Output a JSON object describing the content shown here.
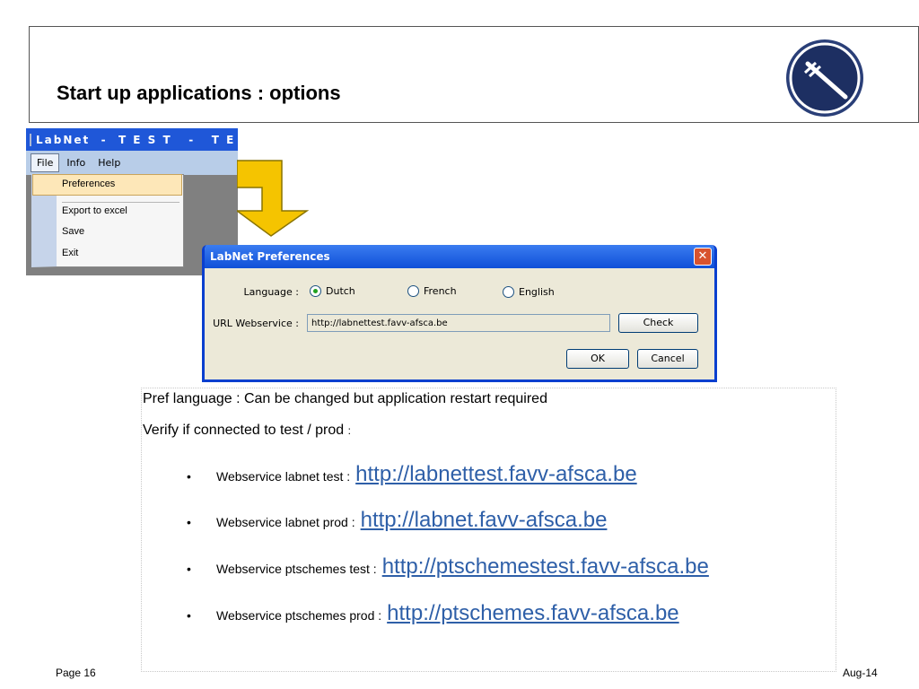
{
  "slide": {
    "title": "Start up applications : options",
    "footer_left": "Page 16",
    "footer_right": "Aug-14"
  },
  "app_window": {
    "title": "LabNet  -  T E S T   -   T E S T",
    "menu": [
      "File",
      "Info",
      "Help"
    ],
    "dropdown": [
      "Preferences",
      "Export to excel",
      "Save",
      "Exit"
    ]
  },
  "dialog": {
    "title": "LabNet Preferences",
    "close_label": "✕",
    "language_label": "Language :",
    "languages": [
      {
        "label": "Dutch",
        "selected": true
      },
      {
        "label": "French",
        "selected": false
      },
      {
        "label": "English",
        "selected": false
      }
    ],
    "url_label": "URL Webservice :",
    "url_value": "http://labnettest.favv-afsca.be",
    "check_button": "Check",
    "ok_button": "OK",
    "cancel_button": "Cancel"
  },
  "content": {
    "line1": "Pref language : Can be changed but application restart required",
    "line2_main": "Verify if connected to test / prod ",
    "line2_colon": ":",
    "bullet_char": "•",
    "bullets": [
      {
        "label": "Webservice labnet test :",
        "url": "http://labnettest.favv-afsca.be"
      },
      {
        "label": "Webservice labnet prod :",
        "url": "http://labnet.favv-afsca.be"
      },
      {
        "label": "Webservice ptschemes test :",
        "url": "http://ptschemestest.favv-afsca.be"
      },
      {
        "label": "Webservice ptschemes prod :",
        "url": "http://ptschemes.favv-afsca.be"
      }
    ]
  },
  "colors": {
    "link": "#2e5fa8",
    "arrow_fill": "#f5c400",
    "logo_navy": "#1d2f62",
    "titlebar_blue": "#1f57d8"
  }
}
